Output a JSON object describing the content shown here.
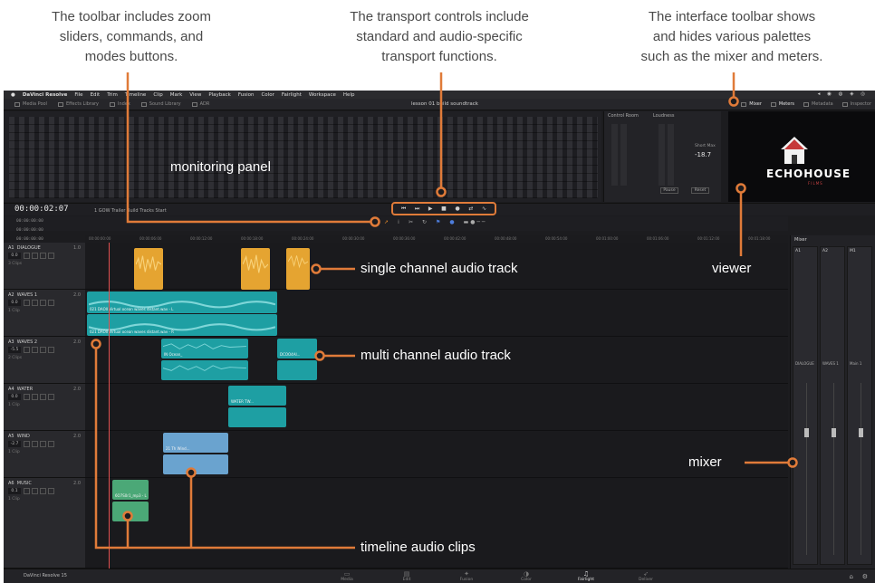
{
  "captions": {
    "toolbar": "The toolbar includes zoom\nsliders, commands, and\nmodes buttons.",
    "transport": "The transport controls include\nstandard and audio-specific\ntransport functions.",
    "interface": "The interface toolbar shows\nand hides various palettes\nsuch as the mixer and meters."
  },
  "annotations": {
    "monitoring": "monitoring panel",
    "single_track": "single channel audio track",
    "viewer": "viewer",
    "multi_track": "multi channel audio track",
    "mixer": "mixer",
    "clips": "timeline audio clips"
  },
  "menubar": [
    "DaVinci Resolve",
    "File",
    "Edit",
    "Trim",
    "Timeline",
    "Clip",
    "Mark",
    "View",
    "Playback",
    "Fusion",
    "Color",
    "Fairlight",
    "Workspace",
    "Help"
  ],
  "toolbar": {
    "left": [
      "Media Pool",
      "Effects Library",
      "Index",
      "Sound Library",
      "ADR"
    ],
    "title": "lesson 01 build soundtrack",
    "right": [
      "Mixer",
      "Meters",
      "Metadata",
      "Inspector"
    ]
  },
  "loudness": {
    "tabs": [
      "Control Room",
      "Loudness"
    ],
    "short_label": "Short Max",
    "short_value": "-18.7",
    "buttons": [
      "Pause",
      "Reset"
    ]
  },
  "viewer": {
    "brand": "ECHOHOUSE",
    "sub": "FILMS"
  },
  "transport_row": {
    "timecode": "00:00:02:07",
    "timeline_name": "1 GOW Trailer Build Tracks Start",
    "buttons": [
      "⏮",
      "⏭",
      "▶",
      "■",
      "●",
      "⇄",
      "∿"
    ]
  },
  "timecodes": [
    "00:00:00:00",
    "00:00:00:00",
    "00:00:00:00"
  ],
  "ruler": [
    "00:00:00:00",
    "00:00:06:00",
    "00:00:12:00",
    "00:00:18:00",
    "00:00:24:00",
    "00:00:30:00",
    "00:00:36:00",
    "00:00:42:00",
    "00:00:48:00",
    "00:00:54:00",
    "00:01:00:00",
    "00:01:06:00",
    "00:01:12:00",
    "00:01:18:00"
  ],
  "tracks": [
    {
      "id": "A1",
      "name": "DIALOGUE",
      "ch": "1.0",
      "vol": "0.0",
      "clips": "3 Clips"
    },
    {
      "id": "A2",
      "name": "WAVES 1",
      "ch": "2.0",
      "vol": "0.0",
      "clips": "1 Clip"
    },
    {
      "id": "A3",
      "name": "WAVES 2",
      "ch": "2.0",
      "vol": "-5.5",
      "clips": "2 Clips"
    },
    {
      "id": "A4",
      "name": "WATER",
      "ch": "2.0",
      "vol": "0.0",
      "clips": "1 Clip"
    },
    {
      "id": "A5",
      "name": "WIND",
      "ch": "2.0",
      "vol": "-2.7",
      "clips": "1 Clip"
    },
    {
      "id": "A6",
      "name": "MUSIC",
      "ch": "2.0",
      "vol": "0.1",
      "clips": "1 Clip"
    }
  ],
  "clips": {
    "a2": "021 DAOII Virtual ocean waves distant.wav - L",
    "a2b": "021 DAOII Virtual ocean waves distant.wav - R",
    "a3a": "IN Ocean_",
    "a3b": "DCOO4AI...",
    "a4": "WATER TW...",
    "a5": "21 Th Wind...",
    "a6": "6O7S0r1_mp3 - L"
  },
  "mixer": {
    "title": "Mixer",
    "strips": [
      "A1",
      "A2",
      "M1"
    ],
    "channel_names": [
      "DIALOGUE",
      "WAVES 1",
      "Main 1"
    ]
  },
  "app_name": "DaVinci Resolve 15",
  "pages": [
    "Media",
    "Edit",
    "Fusion",
    "Color",
    "Fairlight",
    "Deliver"
  ],
  "colors": {
    "accent": "#e07b39",
    "yellow_clip": "#e5a431",
    "teal_clip": "#1e9fa3",
    "blue_clip": "#6aa3cf",
    "green_clip": "#4ba877"
  }
}
